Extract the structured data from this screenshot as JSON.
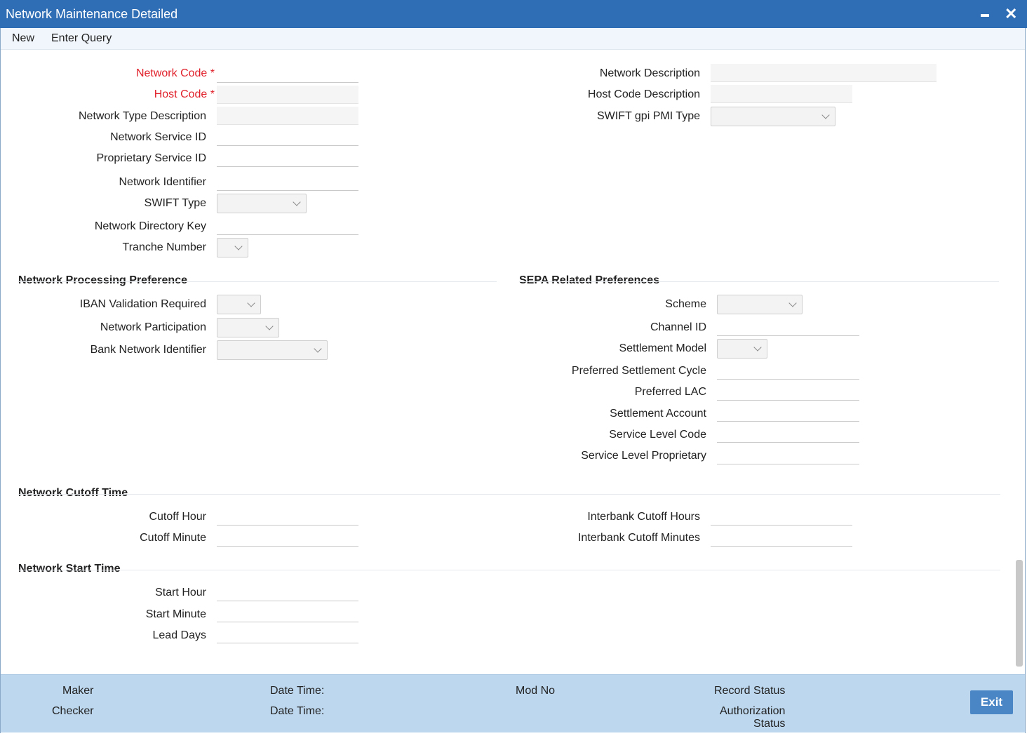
{
  "window": {
    "title": "Network Maintenance Detailed"
  },
  "menu": {
    "new_label": "New",
    "enter_query_label": "Enter Query"
  },
  "fields": {
    "network_code": "Network Code",
    "required_marker": "*",
    "host_code": "Host Code",
    "network_type_description": "Network Type Description",
    "network_service_id": "Network Service ID",
    "proprietary_service_id": "Proprietary Service ID",
    "network_identifier": "Network Identifier",
    "swift_type": "SWIFT Type",
    "network_directory_key": "Network Directory Key",
    "tranche_number": "Tranche Number",
    "network_description": "Network Description",
    "host_code_description": "Host Code Description",
    "swift_gpi_pmi_type": "SWIFT gpi PMI Type"
  },
  "processing": {
    "title": "Network Processing Preference",
    "iban_validation_required": "IBAN Validation Required",
    "network_participation": "Network Participation",
    "bank_network_identifier": "Bank Network Identifier"
  },
  "sepa": {
    "title": "SEPA Related Preferences",
    "scheme": "Scheme",
    "channel_id": "Channel ID",
    "settlement_model": "Settlement Model",
    "preferred_settlement_cycle": "Preferred Settlement Cycle",
    "preferred_lac": "Preferred LAC",
    "settlement_account": "Settlement Account",
    "service_level_code": "Service Level Code",
    "service_level_proprietary": "Service Level Proprietary"
  },
  "cutoff": {
    "title": "Network Cutoff Time",
    "cutoff_hour": "Cutoff Hour",
    "cutoff_minute": "Cutoff Minute",
    "interbank_cutoff_hours": "Interbank Cutoff Hours",
    "interbank_cutoff_minutes": "Interbank Cutoff Minutes"
  },
  "start": {
    "title": "Network Start Time",
    "start_hour": "Start Hour",
    "start_minute": "Start Minute",
    "lead_days": "Lead Days"
  },
  "footer": {
    "maker": "Maker",
    "checker": "Checker",
    "date_time_1": "Date Time:",
    "date_time_2": "Date Time:",
    "mod_no": "Mod No",
    "record_status": "Record Status",
    "authorization": "Authorization",
    "status": "Status",
    "exit_label": "Exit"
  },
  "colors": {
    "title_bar": "#2f6db5",
    "required": "#e0202a",
    "footer": "#bdd7ee",
    "exit_button": "#4a86c6"
  }
}
